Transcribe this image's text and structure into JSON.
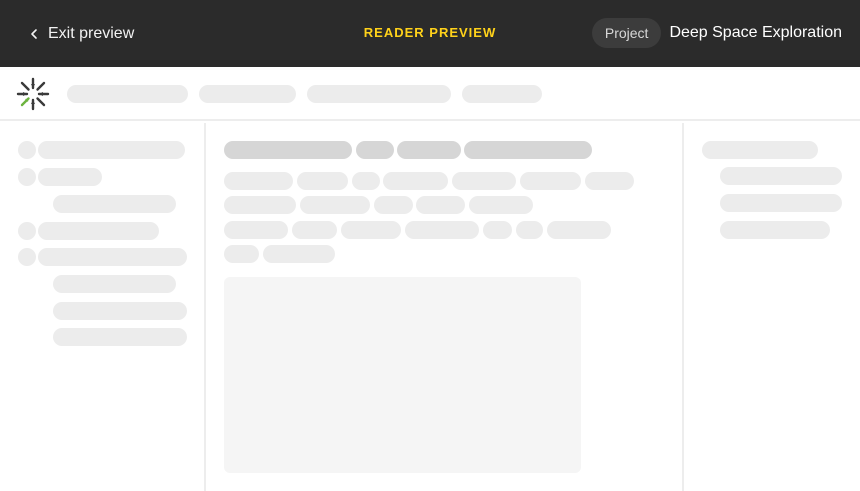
{
  "header": {
    "exit_label": "Exit preview",
    "mode_label": "READER PREVIEW",
    "project_badge": "Project",
    "project_name": "Deep Space Exploration"
  },
  "icons": {
    "back": "chevron-left-icon",
    "logo": "starburst-logo-icon"
  },
  "colors": {
    "topbar_bg": "#2b2b2b",
    "mode_label": "#ffd21a",
    "logo_primary": "#3a3a3a",
    "logo_accent": "#6cb33f",
    "skeleton_light": "#ececec",
    "skeleton_dark": "#d6d6d6"
  },
  "state": "loading"
}
